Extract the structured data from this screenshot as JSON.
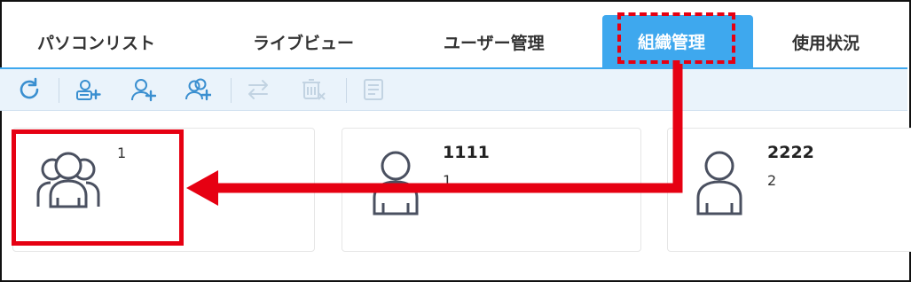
{
  "tabs": [
    {
      "label": "パソコンリスト"
    },
    {
      "label": "ライブビュー"
    },
    {
      "label": "ユーザー管理"
    },
    {
      "label": "組織管理",
      "active": true
    },
    {
      "label": "使用状況"
    }
  ],
  "toolbar": {
    "icons": [
      "refresh-icon",
      "add-group-icon",
      "add-user-icon",
      "add-users-icon",
      "move-icon",
      "delete-icon",
      "details-icon"
    ]
  },
  "cards": [
    {
      "name": "",
      "sub": "1",
      "icon": "group-icon"
    },
    {
      "name": "1111",
      "sub": "1",
      "icon": "user-icon"
    },
    {
      "name": "2222",
      "sub": "2",
      "icon": "user-icon"
    }
  ],
  "colors": {
    "accent": "#3ea8ee",
    "highlight": "#e60012",
    "toolbar_bg": "#eaf3fb",
    "icon_active": "#3a8fd0",
    "icon_disabled": "#c2d3e2"
  }
}
